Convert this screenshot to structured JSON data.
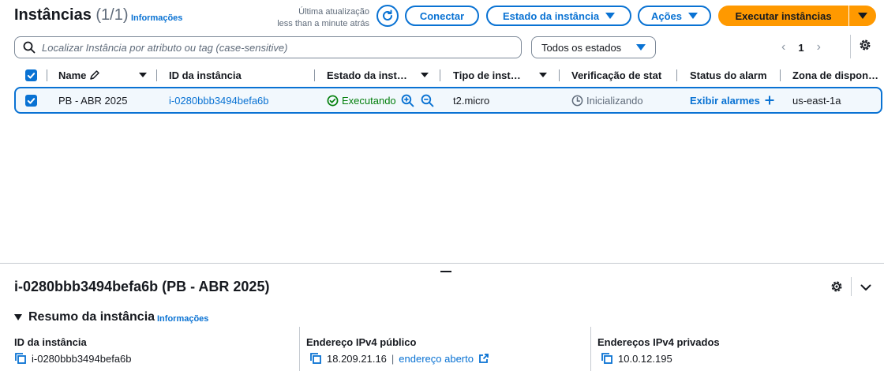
{
  "header": {
    "title": "Instâncias",
    "count": "(1/1)",
    "info_link": "Informações",
    "last_update_label": "Última atualização",
    "last_update_value": "less than a minute atrás",
    "connect_label": "Conectar",
    "instance_state_label": "Estado da instância",
    "actions_label": "Ações",
    "launch_label": "Executar instâncias"
  },
  "filter": {
    "search_placeholder": "Localizar Instância por atributo ou tag (case-sensitive)",
    "states_select": "Todos os estados",
    "page": "1"
  },
  "table": {
    "columns": [
      "Name",
      "ID da instância",
      "Estado da inst…",
      "Tipo de inst…",
      "Verificação de stat",
      "Status do alarm",
      "Zona de dispon…"
    ],
    "rows": [
      {
        "name": "PB - ABR 2025",
        "instance_id": "i-0280bbb3494befa6b",
        "state": "Executando",
        "type": "t2.micro",
        "status_check": "Inicializando",
        "alarm_status": "Exibir alarmes",
        "zone": "us-east-1a"
      }
    ]
  },
  "details": {
    "title": "i-0280bbb3494befa6b (PB - ABR 2025)",
    "summary_label": "Resumo da instância",
    "summary_info": "Informações",
    "fields": [
      {
        "label": "ID da instância",
        "value": "i-0280bbb3494befa6b"
      },
      {
        "label": "Endereço IPv4 público",
        "value": "18.209.21.16",
        "link": "endereço aberto"
      },
      {
        "label": "Endereços IPv4 privados",
        "value": "10.0.12.195"
      }
    ]
  },
  "colors": {
    "accent": "#0972d3",
    "primary_button": "#ff9900",
    "running": "#037f0c",
    "muted": "#5f6b7a"
  }
}
